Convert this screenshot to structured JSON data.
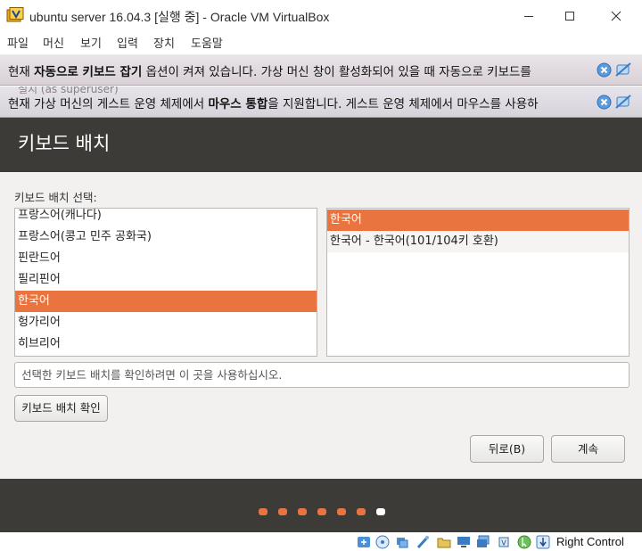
{
  "window": {
    "title": "ubuntu server 16.04.3 [실행 중] - Oracle VM VirtualBox",
    "app_icon": "virtualbox-icon",
    "controls": [
      "minimize-icon",
      "maximize-icon",
      "close-icon"
    ]
  },
  "menu": [
    "파일",
    "머신",
    "보기",
    "입력",
    "장치",
    "도움말"
  ],
  "notifications": [
    {
      "text": "현재 자동으로 키보드 잡기 옵션이 켜져 있습니다. 가상 머신 창이 활성화되어 있을 때 자동으로 키보드를",
      "bold_parts": [
        "자동으로 키보드 잡기"
      ],
      "close_icon": "close-circle-icon",
      "mute_icon": "no-popup-icon"
    },
    {
      "text": "현재 가상 머신의 게스트 운영 체제에서 마우스 통합을 지원합니다. 게스트 운영 체제에서 마우스를 사용하",
      "bold_parts": [
        "마우스 통합"
      ],
      "close_icon": "close-circle-icon",
      "mute_icon": "no-popup-icon",
      "ghost_text": "설치 (as superuser)"
    }
  ],
  "installer": {
    "title": "키보드 배치",
    "select_label": "키보드 배치 선택:",
    "layouts": [
      "프랑스어(캐나다)",
      "프랑스어(콩고 민주 공화국)",
      "핀란드어",
      "필리핀어",
      "한국어",
      "헝가리어",
      "히브리어"
    ],
    "selected_layout": "한국어",
    "variants": [
      "한국어",
      "한국어 - 한국어(101/104키 호환)"
    ],
    "selected_variant": "한국어",
    "test_placeholder": "선택한 키보드 배치를 확인하려면 이 곳을 사용하십시오.",
    "detect_button": "키보드 배치 확인",
    "back_button": "뒤로(B)",
    "continue_button": "계속",
    "progress": {
      "total_steps": 7,
      "current_step": 7,
      "accent_color": "#e9743f"
    }
  },
  "statusbar": {
    "icons": [
      "optical-drive-icon",
      "audio-icon",
      "network-icon",
      "usb-icon",
      "shared-folder-icon",
      "display-icon",
      "video-capture-icon",
      "cpu-icon",
      "mouse-integration-icon",
      "keyboard-icon"
    ],
    "host_key": "Right Control"
  }
}
